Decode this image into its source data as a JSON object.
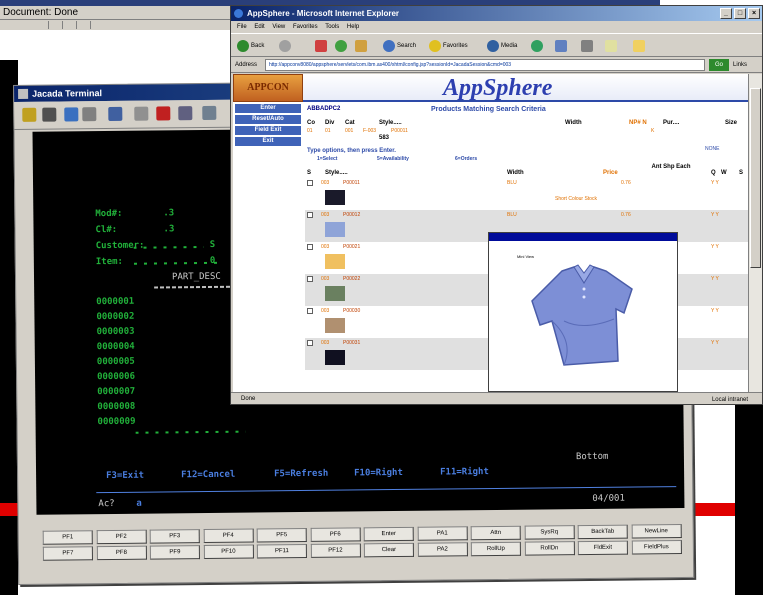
{
  "back_window": {
    "status_text": "Document: Done",
    "stray_text": "a"
  },
  "terminal": {
    "title": "Jacada Terminal",
    "screen": {
      "labels": [
        "Mod#:",
        "Cl#:",
        "Customer:",
        "Item:"
      ],
      "field_values": [
        ".3",
        ".3",
        "S",
        "0"
      ],
      "column_header": "PART_DESC",
      "rows": [
        "0000001",
        "0000002",
        "0000003",
        "0000004",
        "0000005",
        "0000006",
        "0000007",
        "0000008",
        "0000009"
      ],
      "status_bottom": "Bottom",
      "function_keys": [
        "F3=Exit",
        "F12=Cancel",
        "F5=Refresh",
        "F10=Right",
        "F11=Right"
      ],
      "command_prompt": "Ac? ",
      "command_value": "a",
      "page_counter": "04/001"
    },
    "keyboard": {
      "row1": [
        "PF1",
        "PF2",
        "PF3",
        "PF4",
        "PF5",
        "PF6",
        "Enter",
        "PA1",
        "Attn",
        "SysRq",
        "BackTab",
        "NewLine"
      ],
      "row2": [
        "PF7",
        "PF8",
        "PF9",
        "PF10",
        "PF11",
        "PF12",
        "Clear",
        "PA2",
        "RollUp",
        "RollDn",
        "FldExit",
        "FieldPlus"
      ]
    }
  },
  "browser": {
    "title": "AppSphere - Microsoft Internet Explorer",
    "menu_items": [
      "File",
      "Edit",
      "View",
      "Favorites",
      "Tools",
      "Help"
    ],
    "toolbar": {
      "back": "Back",
      "search": "Search",
      "favorites": "Favorites",
      "media": "Media"
    },
    "address_label": "Address",
    "address_value": "http://appconv8080/appsphere/servlets/com.ibm.as400/xhtml/config.jsp?sessionId=JacadaSession&cmd=003",
    "go_label": "Go",
    "links_label": "Links",
    "status_left": "Done",
    "status_right": "Local intranet",
    "page": {
      "logo_text": "APPCON",
      "brand": "AppSphere",
      "program_id": "ABBADPC2",
      "heading": "Products Matching Search Criteria",
      "sidebar_buttons": [
        "Enter",
        "Reset/Auto",
        "Field Exit",
        "Exit"
      ],
      "criteria_labels": [
        "Co",
        "Div",
        "Cat",
        "Style.....",
        "Width",
        "NP# N",
        "Pur....",
        "Size"
      ],
      "criteria_values": [
        "01",
        "01",
        "001",
        "F-003",
        "P00011",
        "K"
      ],
      "qty_value": "583",
      "none_label": "NONE",
      "instructions": [
        "Type options, then press Enter.",
        "1=Select",
        "5=Availability",
        "6=Orders"
      ],
      "column_headers": [
        "S",
        "Style.....",
        "Width",
        "Price",
        "Ant Shp Each",
        "Q",
        "W",
        "S"
      ],
      "rows": [
        {
          "code": "003",
          "style": "P00011",
          "width": "BLU",
          "price": "0.76",
          "extra": "Y Y"
        },
        {
          "code": "003",
          "style": "P00012",
          "width": "BLU",
          "price": "0.76",
          "extra": "Y Y"
        },
        {
          "code": "003",
          "style": "P00021",
          "width": "",
          "price": "",
          "extra": "Y Y"
        },
        {
          "code": "003",
          "style": "P00022",
          "width": "",
          "price": "",
          "extra": "Y Y"
        },
        {
          "code": "003",
          "style": "P00030",
          "width": "",
          "price": "",
          "extra": "Y Y"
        },
        {
          "code": "003",
          "style": "P00031",
          "width": "",
          "price": "",
          "extra": "Y Y"
        }
      ],
      "row_note": "Short Colour Stock",
      "popup_label": "Mini View",
      "colors": {
        "brand": "#2d3fb0",
        "sidebar": "#3f63b8",
        "value_text": "#e07000",
        "swatch_1": "#1a1a2a",
        "swatch_2": "#8fa4d8",
        "swatch_3": "#f0c060",
        "swatch_4": "#6a8060",
        "swatch_5": "#b09070",
        "swatch_6": "#101020",
        "polo": "#7d8fd6"
      }
    }
  }
}
